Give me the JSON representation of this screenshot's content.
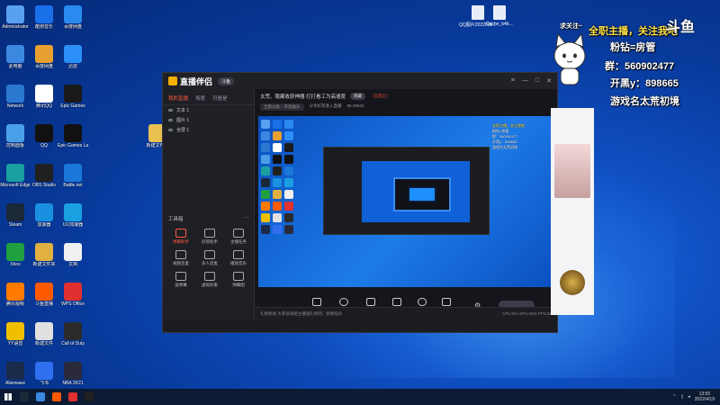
{
  "desktop": {
    "col1": [
      {
        "label": "Administrator",
        "color": "#5aa0f0"
      },
      {
        "label": "此电脑",
        "color": "#3a88e0"
      },
      {
        "label": "Network",
        "color": "#2a78d0"
      },
      {
        "label": "控制面板",
        "color": "#4aa0e8"
      },
      {
        "label": "Microsoft Edge",
        "color": "#1aa0a0"
      },
      {
        "label": "Steam",
        "color": "#1b2838"
      },
      {
        "label": "Xbox",
        "color": "#20a040"
      },
      {
        "label": "腾讯视频",
        "color": "#ff7a00"
      },
      {
        "label": "YY语音",
        "color": "#f0c000"
      },
      {
        "label": "Alienware",
        "color": "#1a2a4a"
      }
    ],
    "col2": [
      {
        "label": "酷狗音乐",
        "color": "#1a70e8"
      },
      {
        "label": "百度网盘",
        "color": "#e8a030"
      },
      {
        "label": "腾讯QQ",
        "color": "#ffffff"
      },
      {
        "label": "QQ",
        "color": "#111111"
      },
      {
        "label": "OBS Studio",
        "color": "#202020"
      },
      {
        "label": "加速器",
        "color": "#1a90e0"
      },
      {
        "label": "新建文件夹",
        "color": "#e0b040"
      },
      {
        "label": "斗鱼直播",
        "color": "#ff5a00"
      },
      {
        "label": "新建文件",
        "color": "#e0e0e0"
      },
      {
        "label": "飞书",
        "color": "#3070f0"
      }
    ],
    "col3": [
      {
        "label": "百度网盘",
        "color": "#2a8af0"
      },
      {
        "label": "迅雷",
        "color": "#2a90f8"
      },
      {
        "label": "Epic Games",
        "color": "#1a1a1a"
      },
      {
        "label": "Epic Games Launcher",
        "color": "#111111"
      },
      {
        "label": "Battle.net",
        "color": "#1a78d8"
      },
      {
        "label": "UU加速器",
        "color": "#1aa0e0"
      },
      {
        "label": "文档",
        "color": "#f0f0f0"
      },
      {
        "label": "WPS Office",
        "color": "#e03030"
      },
      {
        "label": "Call of Duty",
        "color": "#2a2a2a"
      },
      {
        "label": "NBA 2K21",
        "color": "#2a2a3a"
      }
    ],
    "single_folder": {
      "label": "新建文件夹"
    },
    "top_files": [
      {
        "label": "QQ图片2022030..."
      },
      {
        "label": "Cache_b4b..."
      }
    ]
  },
  "overlay": {
    "follow_text": "求关注~",
    "main_slogan": "全职主播，关注我吧",
    "line_fans": "粉钻=房管",
    "line_group": "群：560902477",
    "line_open": "开黑y：898665",
    "line_game": "游戏名太荒初境",
    "douyu_logo": "斗鱼"
  },
  "app": {
    "title": "直播伴侣",
    "badge": "斗鱼",
    "left_tabs": [
      "我的直播",
      "场景",
      "可是是"
    ],
    "sources": [
      "文本 1",
      "图片 1",
      "全屏 1"
    ],
    "tools_header": "工具箱",
    "tools": [
      "弹幕助手",
      "房管助手",
      "主播任务",
      "视频连麦",
      "多人连麦",
      "播放音乐",
      "送弹幕",
      "虚拟形象",
      "弹幕图"
    ],
    "main_title": "太荒、隐藏收获神器 打打看工为高速度",
    "main_badge": "隐藏",
    "main_red": "（已禁止）",
    "main_row2": [
      "全部分类：开黑娱乐",
      "分享好友进入直播",
      "96.29542"
    ],
    "controls": [
      "直播屏幕",
      "摄像头",
      "手机投屏",
      "多媒体",
      "麦克风",
      "扬声器"
    ],
    "status_left": "礼物感谢  大家快来给主播送礼物吧，谢谢观众",
    "status_right": "CPU:8%  GPU:26%  FPS:60"
  },
  "preview_text": [
    "全职主播，关注我吧",
    "粉钻=房管",
    "群：560902477",
    "开黑y：898665",
    "游戏名太荒初境"
  ],
  "taskbar": {
    "apps": [
      {
        "name": "steam",
        "color": "#1b2838"
      },
      {
        "name": "chrome",
        "color": "#3a88e0"
      },
      {
        "name": "douyu",
        "color": "#ff5a00"
      },
      {
        "name": "game",
        "color": "#e03030"
      },
      {
        "name": "obs",
        "color": "#202020"
      }
    ],
    "time": "13:55",
    "date": "2022/4/19"
  }
}
